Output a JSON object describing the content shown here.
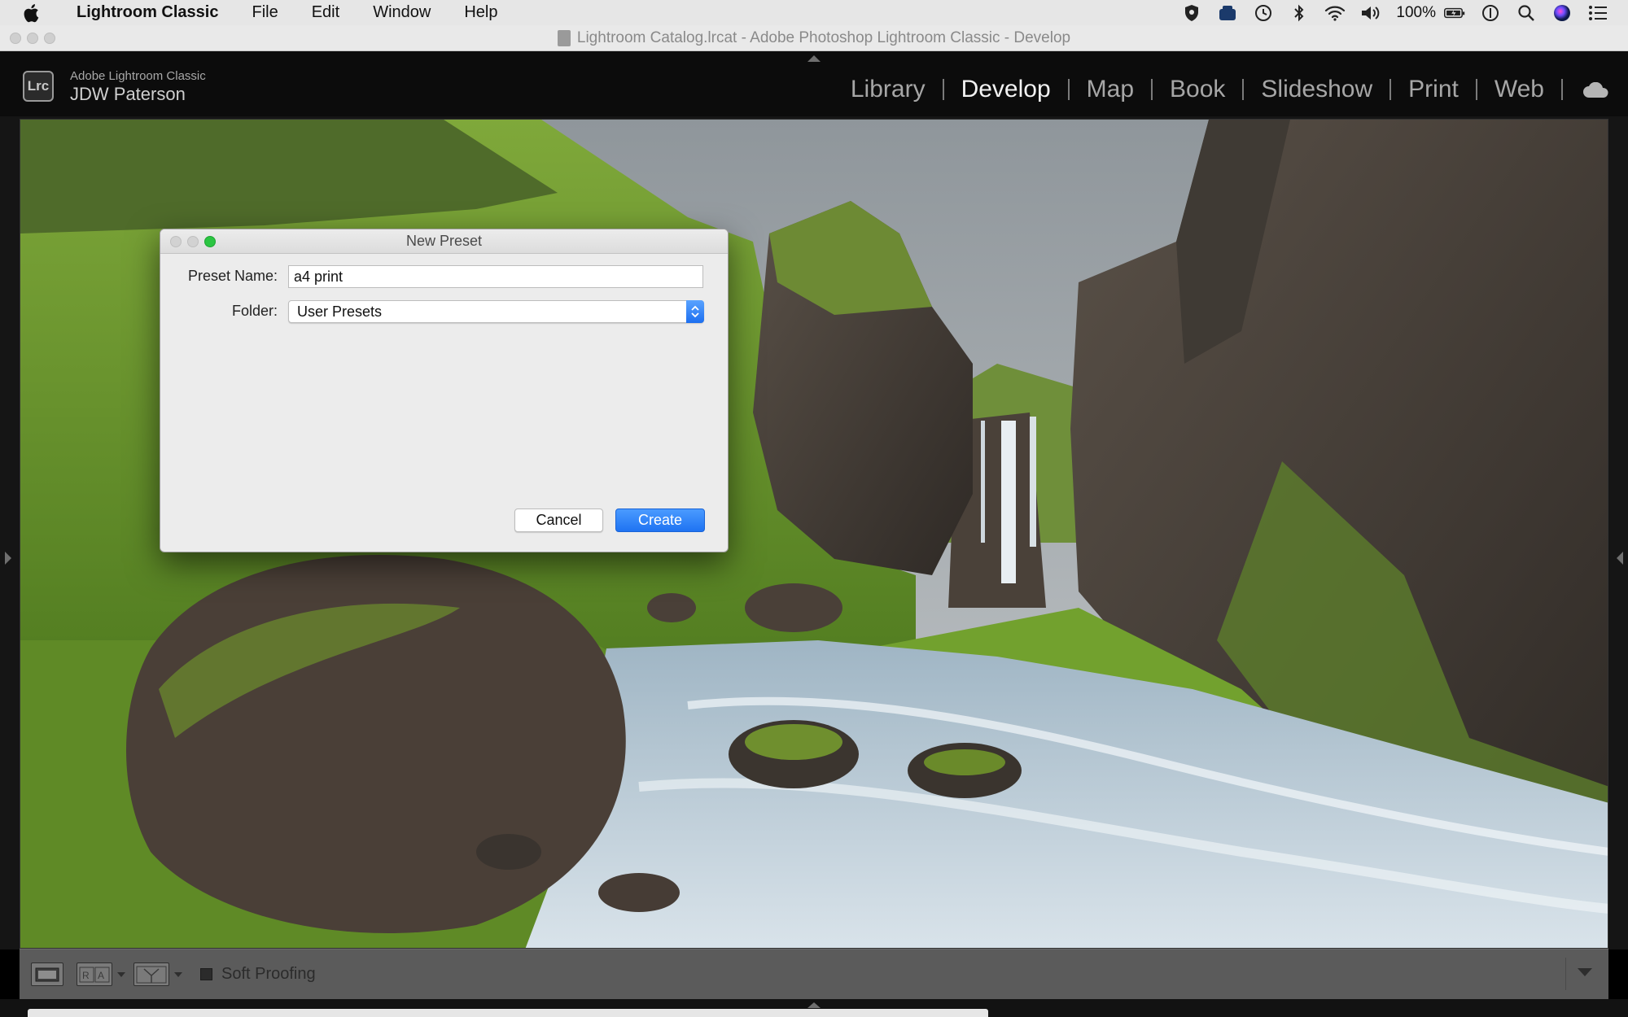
{
  "menubar": {
    "app_name": "Lightroom Classic",
    "items": [
      "File",
      "Edit",
      "Window",
      "Help"
    ],
    "battery": "100%"
  },
  "window": {
    "title": "Lightroom Catalog.lrcat - Adobe Photoshop Lightroom Classic - Develop"
  },
  "header": {
    "logo_text": "Lrc",
    "product": "Adobe Lightroom Classic",
    "user": "JDW Paterson",
    "modules": [
      "Library",
      "Develop",
      "Map",
      "Book",
      "Slideshow",
      "Print",
      "Web"
    ],
    "active_module": "Develop"
  },
  "dialog": {
    "title": "New Preset",
    "preset_name_label": "Preset Name:",
    "preset_name_value": "a4 print",
    "folder_label": "Folder:",
    "folder_value": "User Presets",
    "cancel_label": "Cancel",
    "create_label": "Create"
  },
  "toolbar": {
    "soft_proofing_label": "Soft Proofing",
    "soft_proofing_checked": false
  },
  "colors": {
    "accent_blue": "#1f73f2",
    "active_module": "#f2f2f2",
    "inactive_module": "#a6a6a6"
  }
}
